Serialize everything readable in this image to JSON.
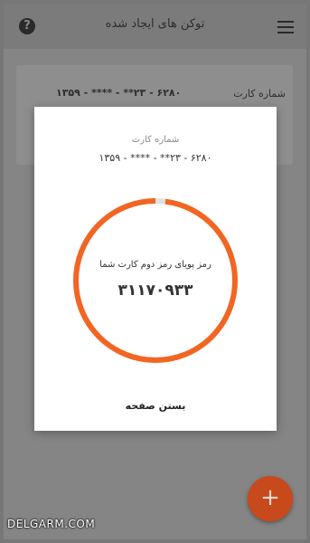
{
  "appbar": {
    "title": "توکن های ایجاد شده"
  },
  "icons": {
    "help": "question-circle-icon",
    "menu": "hamburger-menu-icon",
    "fab": "plus-icon"
  },
  "list_card": {
    "label": "شماره کارت",
    "number": "۶۲۸۰ - ۲۳** - **** - ۱۳۵۹"
  },
  "dialog": {
    "card_label": "شماره کارت",
    "card_number": "۶۲۸۰ - ۲۳** - **** - ۱۳۵۹",
    "dynamic_label": "رمز پویای رمز دوم کارت  شما",
    "code": "۳۱۱۷۰۹۳۳",
    "close_label": "بستن صفحه",
    "timer_remaining_fraction": 0.98
  },
  "fab": {
    "label": "+"
  },
  "watermark": "DELGARM.COM",
  "colors": {
    "accent": "#f26522",
    "ring_track": "#e0e0e0",
    "fab": "#c8491c"
  }
}
